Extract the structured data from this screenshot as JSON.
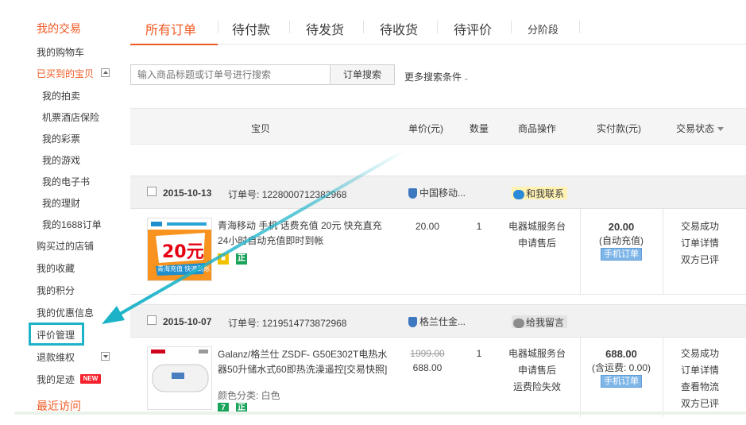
{
  "sidebar": {
    "heading_trade": "我的交易",
    "cart": "我的购物车",
    "bought": "已买到的宝贝",
    "sub_items": [
      "我的拍卖",
      "机票酒店保险",
      "我的彩票",
      "我的游戏",
      "我的电子书",
      "我的理财",
      "我的1688订单"
    ],
    "items": [
      "购买过的店铺",
      "我的收藏",
      "我的积分",
      "我的优惠信息"
    ],
    "review": "评价管理",
    "refund": "退款维权",
    "footprint": "我的足迹",
    "new_badge": "NEW",
    "recent": "最近访问"
  },
  "tabs": [
    "所有订单",
    "待付款",
    "待发货",
    "待收货",
    "待评价",
    "分阶段"
  ],
  "search": {
    "placeholder": "输入商品标题或订单号进行搜索",
    "button": "订单搜索",
    "more": "更多搜索条件"
  },
  "table_header": {
    "item": "宝贝",
    "price": "单价(元)",
    "qty": "数量",
    "ops": "商品操作",
    "paid": "实付款(元)",
    "status": "交易状态"
  },
  "orders": [
    {
      "date": "2015-10-13",
      "number_label": "订单号:",
      "number": "1228000712382968",
      "shop": "中国移动...",
      "contact": "和我联系",
      "title": "青海移动 手机 话费充值 20元 快充直充 24小时自动充值即时到帐",
      "thumb_value": "20元",
      "thumb_caption": "青海充值 快速到账",
      "badge": "正",
      "price": "20.00",
      "qty": "1",
      "ops": [
        "电器城服务台",
        "申请售后"
      ],
      "paid": "20.00",
      "paid_note": "(自动充值)",
      "paid_tag": "手机订单",
      "status": [
        "交易成功",
        "订单详情",
        "双方已评"
      ]
    },
    {
      "date": "2015-10-07",
      "number_label": "订单号:",
      "number": "1219514773872968",
      "shop": "格兰仕金...",
      "contact": "给我留言",
      "title": "Galanz/格兰仕 ZSDF- G50E302T电热水器50升储水式60即热洗澡遥控[交易快照]",
      "sku": "颜色分类: 白色",
      "badge_7": "7",
      "badge": "正",
      "price_original": "1999.00",
      "price": "688.00",
      "qty": "1",
      "ops": [
        "电器城服务台",
        "申请售后",
        "运费险失效"
      ],
      "paid": "688.00",
      "paid_note": "(含运费: 0.00)",
      "paid_tag": "手机订单",
      "status": [
        "交易成功",
        "订单详情",
        "查看物流",
        "双方已评"
      ]
    }
  ],
  "colors": {
    "accent": "#f15a24",
    "annotation": "#1cb3c8"
  }
}
